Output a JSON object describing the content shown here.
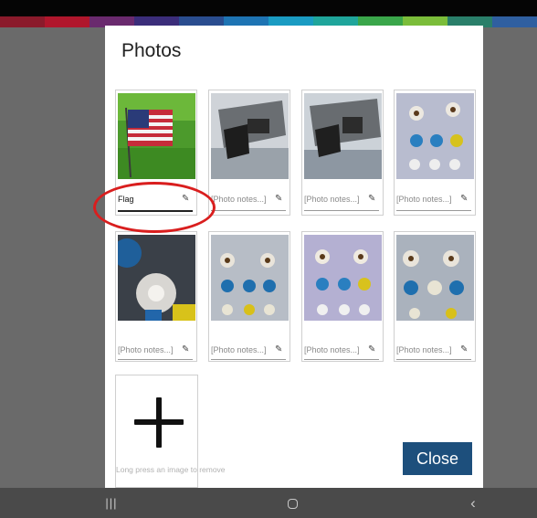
{
  "dialog": {
    "title": "Photos",
    "close_label": "Close",
    "add_hint": "Long press an image to remove"
  },
  "photos": [
    {
      "note": "Flag",
      "filled": true,
      "icon": "pencil-icon"
    },
    {
      "note": "[Photo notes...]",
      "filled": false,
      "icon": "pencil-icon"
    },
    {
      "note": "[Photo notes...]",
      "filled": false,
      "icon": "pencil-icon"
    },
    {
      "note": "[Photo notes...]",
      "filled": false,
      "icon": "pencil-icon"
    },
    {
      "note": "[Photo notes...]",
      "filled": false,
      "icon": "pencil-icon"
    },
    {
      "note": "[Photo notes...]",
      "filled": false,
      "icon": "pencil-icon"
    },
    {
      "note": "[Photo notes...]",
      "filled": false,
      "icon": "pencil-icon"
    },
    {
      "note": "[Photo notes...]",
      "filled": false,
      "icon": "pencil-icon"
    }
  ],
  "colors": {
    "close_button": "#1d4f7c",
    "highlight_ring": "#d91e1e",
    "top_strip": [
      "#8b1a2b",
      "#b0162c",
      "#6a2a6e",
      "#3b2d7a",
      "#2a4d8f",
      "#1e74b3",
      "#1a9bc2",
      "#1fa59b",
      "#3aa64a",
      "#7bbd3a",
      "#2a7f6a",
      "#2f5fa0"
    ]
  },
  "navigation": {
    "recent_icon": "recent-apps-icon",
    "home_icon": "home-icon",
    "back_icon": "back-icon"
  }
}
